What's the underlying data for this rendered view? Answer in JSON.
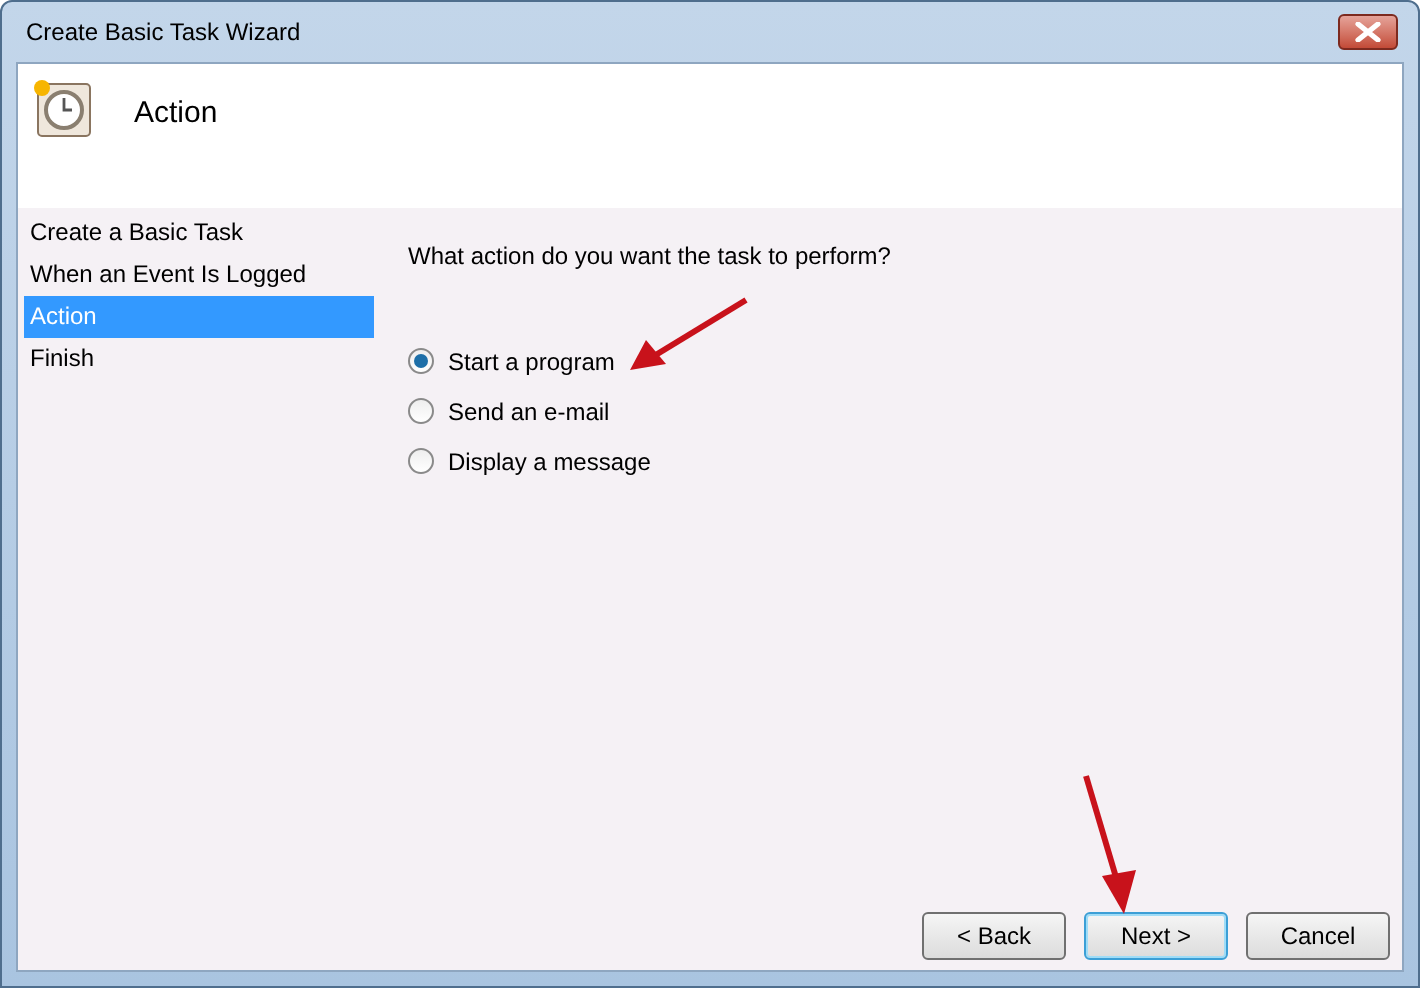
{
  "window": {
    "title": "Create Basic Task Wizard"
  },
  "header": {
    "title": "Action"
  },
  "steps": [
    {
      "label": "Create a Basic Task",
      "selected": false
    },
    {
      "label": "When an Event Is Logged",
      "selected": false
    },
    {
      "label": "Action",
      "selected": true
    },
    {
      "label": "Finish",
      "selected": false
    }
  ],
  "question": "What action do you want the task to perform?",
  "options": [
    {
      "label": "Start a program",
      "selected": true
    },
    {
      "label": "Send an e-mail",
      "selected": false
    },
    {
      "label": "Display a message",
      "selected": false
    }
  ],
  "buttons": [
    {
      "label": "< Back",
      "focused": false
    },
    {
      "label": "Next >",
      "focused": true
    },
    {
      "label": "Cancel",
      "focused": false
    }
  ]
}
